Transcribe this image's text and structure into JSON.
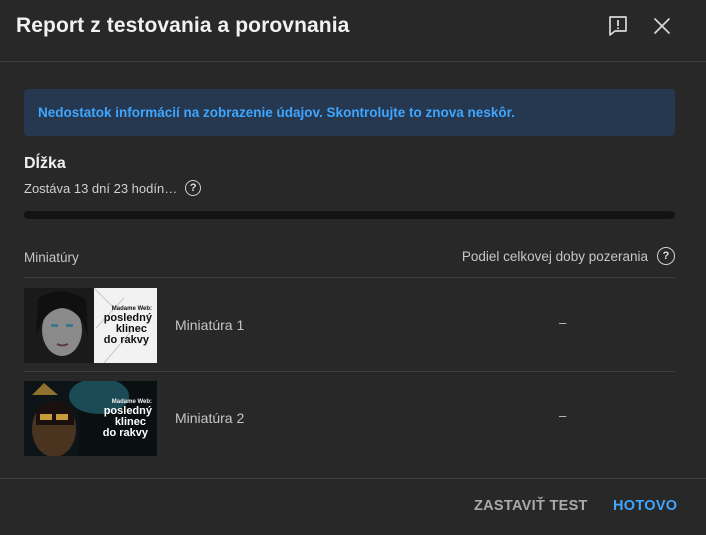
{
  "dialog": {
    "title": "Report z testovania a porovnania",
    "feedback_icon": "feedback-icon",
    "close_icon": "close-icon"
  },
  "banner": {
    "text": "Nedostatok informácií na zobrazenie údajov. Skontrolujte to znova neskôr."
  },
  "length": {
    "title": "Dĺžka",
    "remaining": "Zostáva 13 dní 23 hodín…",
    "help_glyph": "?",
    "progress_fraction": 0.0
  },
  "table": {
    "columns": {
      "thumbnail": "Miniatúry",
      "share": "Podiel celkovej doby pozerania"
    },
    "help_glyph": "?",
    "rows": [
      {
        "name": "Miniatúra 1",
        "value": "–",
        "overlay_lines": [
          "Madame Web:",
          "posledný",
          "klinec",
          "do rakvy"
        ]
      },
      {
        "name": "Miniatúra 2",
        "value": "–",
        "overlay_lines": [
          "Madame Web:",
          "posledný",
          "klinec",
          "do rakvy"
        ]
      }
    ]
  },
  "footer": {
    "stop_label": "ZASTAVIŤ TEST",
    "done_label": "HOTOVO"
  },
  "colors": {
    "background": "#282828",
    "accent": "#3ea6ff",
    "banner_bg": "#263850",
    "divider": "#3d3d3d"
  }
}
